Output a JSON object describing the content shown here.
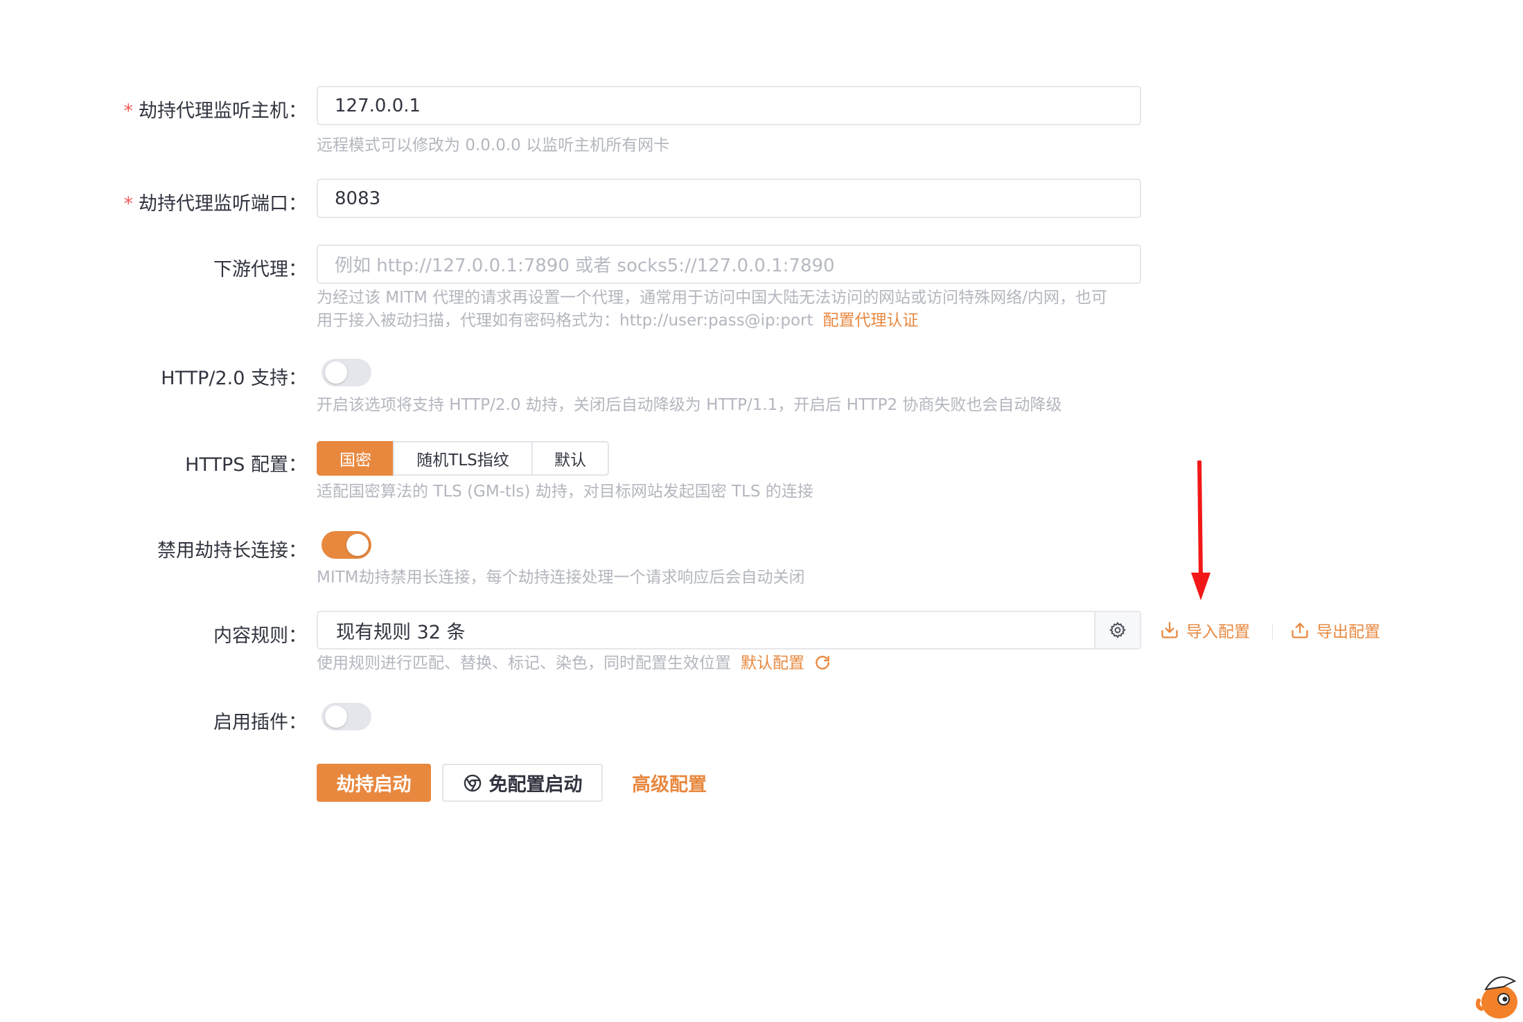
{
  "form": {
    "host": {
      "label": "劫持代理监听主机：",
      "required_mark": "*",
      "value": "127.0.0.1",
      "help": "远程模式可以修改为 0.0.0.0 以监听主机所有网卡"
    },
    "port": {
      "label": "劫持代理监听端口：",
      "required_mark": "*",
      "value": "8083"
    },
    "downstream": {
      "label": "下游代理：",
      "placeholder": "例如 http://127.0.0.1:7890 或者 socks5://127.0.0.1:7890",
      "help_line1": "为经过该 MITM 代理的请求再设置一个代理，通常用于访问中国大陆无法访问的网站或访问特殊网络/内网，也可",
      "help_line2": "用于接入被动扫描，代理如有密码格式为：http://user:pass@ip:port",
      "help_link": "配置代理认证"
    },
    "http2": {
      "label": "HTTP/2.0 支持：",
      "enabled": false,
      "help": "开启该选项将支持 HTTP/2.0 劫持，关闭后自动降级为 HTTP/1.1，开启后 HTTP2 协商失败也会自动降级"
    },
    "https": {
      "label": "HTTPS 配置：",
      "options": [
        "国密",
        "随机TLS指纹",
        "默认"
      ],
      "selected": "国密",
      "help": "适配国密算法的 TLS (GM-tls) 劫持，对目标网站发起国密 TLS 的连接"
    },
    "disable_keepalive": {
      "label": "禁用劫持长连接：",
      "enabled": true,
      "help": "MITM劫持禁用长连接，每个劫持连接处理一个请求响应后会自动关闭"
    },
    "content_rules": {
      "label": "内容规则：",
      "value": "现有规则 32 条",
      "import_label": "导入配置",
      "export_label": "导出配置",
      "help": "使用规则进行匹配、替换、标记、染色，同时配置生效位置",
      "help_link": "默认配置"
    },
    "plugins": {
      "label": "启用插件：",
      "enabled": false
    }
  },
  "actions": {
    "start": "劫持启动",
    "no_config_start": "免配置启动",
    "advanced": "高级配置"
  },
  "colors": {
    "accent": "#e8883f",
    "annotation_arrow": "#f21818"
  },
  "icons": [
    "settings-gear-icon",
    "import-icon",
    "export-icon",
    "refresh-icon",
    "chrome-icon",
    "annotation-arrow",
    "mascot-icon"
  ]
}
